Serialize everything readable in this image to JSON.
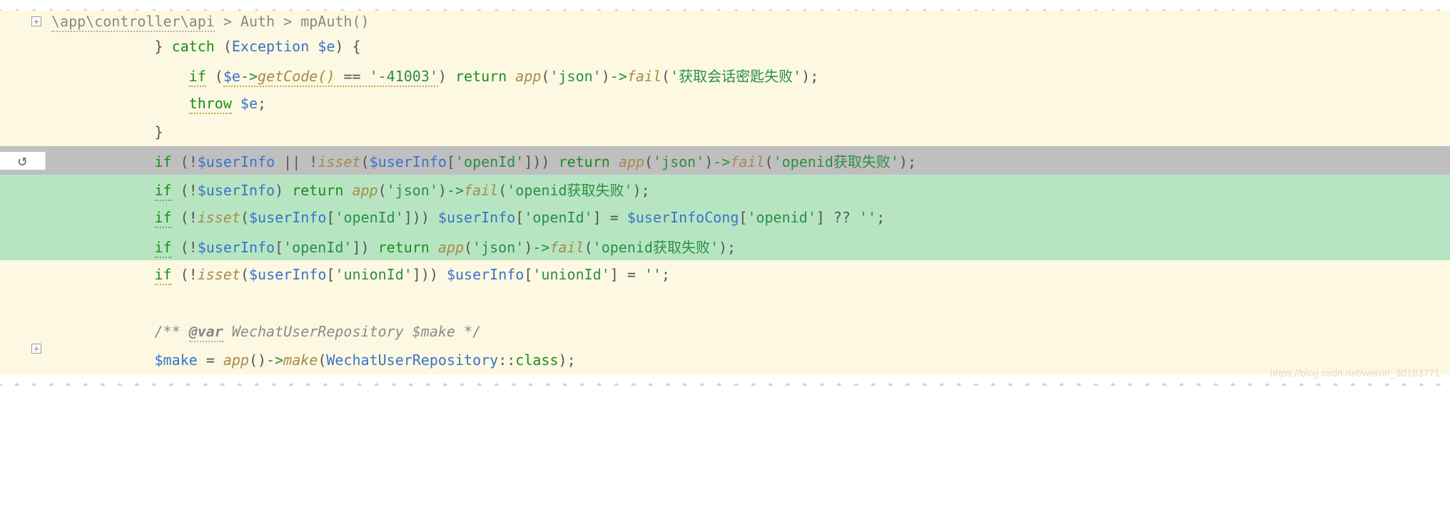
{
  "breadcrumb": {
    "path": "\\app\\controller\\api",
    "sep": " > ",
    "class": "Auth",
    "method": "mpAuth()"
  },
  "icons": {
    "expand": "+",
    "rollback": "↺"
  },
  "code": {
    "l1": {
      "indent": "            ",
      "brace_close": "}",
      "catch": " catch ",
      "paren_o": "(",
      "exception": "Exception ",
      "evar": "$e",
      "paren_c": ")",
      "brace_open": " {"
    },
    "l2": {
      "indent": "                ",
      "if": "if",
      "sp": " ",
      "po": "(",
      "evar": "$e",
      "arrow": "->",
      "getcode": "getCode()",
      "eq": " == ",
      "num": "'-41003'",
      "pc": ")",
      "ret": " return ",
      "app": "app",
      "po2": "(",
      "json": "'json'",
      "pc2": ")",
      "arrow2": "->",
      "fail": "fail",
      "po3": "(",
      "str": "'获取会话密匙失败'",
      "pc3": ")",
      "semi": ";"
    },
    "l3": {
      "indent": "                ",
      "throw": "throw",
      "sp": " ",
      "evar": "$e",
      "semi": ";"
    },
    "l4": {
      "indent": "            ",
      "brace_close": "}"
    },
    "l5": {
      "indent": "            ",
      "if": "if",
      "po": " (",
      "not": "!",
      "userinfo": "$userInfo",
      "or": " || !",
      "isset": "isset",
      "po2": "(",
      "userinfo2": "$userInfo",
      "br_o": "[",
      "key": "'openId'",
      "br_c": "]",
      "pc2": "))",
      "ret": " return ",
      "app": "app",
      "po3": "(",
      "json": "'json'",
      "pc3": ")",
      "arrow": "->",
      "fail": "fail",
      "po4": "(",
      "str": "'openid获取失败'",
      "pc4": ")",
      "semi": ";"
    },
    "l6": {
      "indent": "            ",
      "if": "if",
      "po": " (!",
      "userinfo": "$userInfo",
      "pc": ")",
      "ret": " return ",
      "app": "app",
      "po2": "(",
      "json": "'json'",
      "pc2": ")",
      "arrow": "->",
      "fail": "fail",
      "po3": "(",
      "str": "'openid获取失败'",
      "pc3": ")",
      "semi": ";"
    },
    "l7": {
      "indent": "            ",
      "if": "if",
      "po": " (!",
      "isset": "isset",
      "po2": "(",
      "userinfo": "$userInfo",
      "br_o": "[",
      "key": "'openId'",
      "br_c": "]",
      "pc2": "))",
      "sp": " ",
      "userinfo2": "$userInfo",
      "br_o2": "[",
      "key2": "'openId'",
      "br_c2": "]",
      "eq": " = ",
      "usercong": "$userInfoCong",
      "br_o3": "[",
      "key3": "'openid'",
      "br_c3": "]",
      "nullco": " ?? ",
      "empty": "''",
      "semi": ";"
    },
    "l8": {
      "indent": "            ",
      "if": "if",
      "po": " (!",
      "userinfo": "$userInfo",
      "br_o": "[",
      "key": "'openId'",
      "br_c": "]",
      "pc": ")",
      "ret": " return ",
      "app": "app",
      "po2": "(",
      "json": "'json'",
      "pc2": ")",
      "arrow": "->",
      "fail": "fail",
      "po3": "(",
      "str": "'openid获取失败'",
      "pc3": ")",
      "semi": ";"
    },
    "l9": {
      "indent": "            ",
      "if": "if",
      "po": " (!",
      "isset": "isset",
      "po2": "(",
      "userinfo": "$userInfo",
      "br_o": "[",
      "key": "'unionId'",
      "br_c": "]",
      "pc2": "))",
      "sp": " ",
      "userinfo2": "$userInfo",
      "br_o2": "[",
      "key2": "'unionId'",
      "br_c2": "]",
      "eq": " = ",
      "empty": "''",
      "semi": ";"
    },
    "l11": {
      "indent": "            ",
      "open": "/** ",
      "tag": "@var",
      "sp": " ",
      "type": "WechatUserRepository",
      "sp2": " ",
      "varname": "$make",
      "close": " */"
    },
    "l12": {
      "indent": "            ",
      "make": "$make",
      "eq": " = ",
      "app": "app",
      "po": "()",
      "arrow": "->",
      "makefn": "make",
      "po2": "(",
      "cls": "WechatUserRepository",
      "colcol": "::",
      "class": "class",
      "pc2": ")",
      "semi": ";"
    }
  },
  "watermark": "https://blog.csdn.net/weixin_30183771"
}
